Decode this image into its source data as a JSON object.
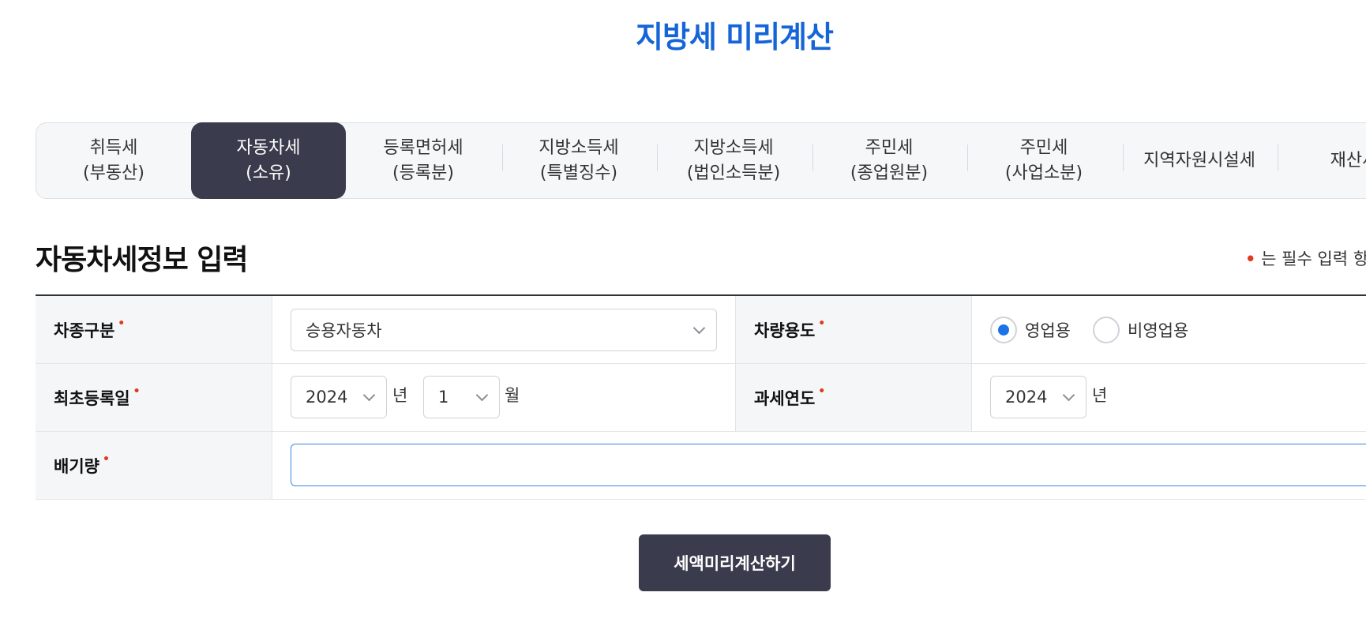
{
  "page_title": "지방세 미리계산",
  "tabs": [
    {
      "line1": "취득세",
      "line2": "(부동산)"
    },
    {
      "line1": "자동차세",
      "line2": "(소유)"
    },
    {
      "line1": "등록면허세",
      "line2": "(등록분)"
    },
    {
      "line1": "지방소득세",
      "line2": "(특별징수)"
    },
    {
      "line1": "지방소득세",
      "line2": "(법인소득분)"
    },
    {
      "line1": "주민세",
      "line2": "(종업원분)"
    },
    {
      "line1": "주민세",
      "line2": "(사업소분)"
    },
    {
      "line1": "지역자원시설세",
      "line2": ""
    },
    {
      "line1": "재산세",
      "line2": ""
    }
  ],
  "active_tab_index": 1,
  "section_title": "자동차세정보 입력",
  "required_note": "는 필수 입력 항목",
  "required_marker": "•",
  "form": {
    "vehicle_type": {
      "label": "차종구분",
      "value": "승용자동차"
    },
    "vehicle_use": {
      "label": "차량용도",
      "options": [
        {
          "label": "영업용",
          "checked": true
        },
        {
          "label": "비영업용",
          "checked": false
        }
      ]
    },
    "first_registration": {
      "label": "최초등록일",
      "year": "2024",
      "year_unit": "년",
      "month": "1",
      "month_unit": "월"
    },
    "tax_year": {
      "label": "과세연도",
      "year": "2024",
      "year_unit": "년"
    },
    "displacement": {
      "label": "배기량",
      "value": ""
    }
  },
  "submit_label": "세액미리계산하기",
  "colors": {
    "title": "#1565d8",
    "active_tab": "#3a3b4c",
    "required": "#e0391b",
    "focus": "#3a86e6"
  }
}
